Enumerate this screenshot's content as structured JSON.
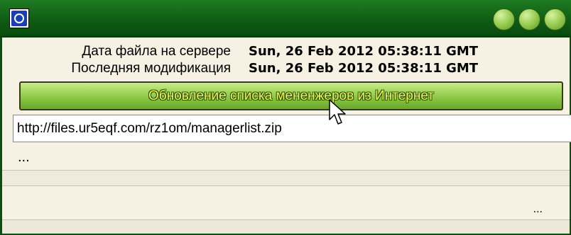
{
  "window": {
    "icon": "app-icon",
    "controls": [
      "minimize-button",
      "maximize-button",
      "close-button"
    ]
  },
  "info": {
    "server_date_label": "Дата файла на сервере",
    "server_date_value": "Sun, 26 Feb 2012 05:38:11 GMT",
    "modified_label": "Последняя модификация",
    "modified_value": "Sun, 26 Feb 2012 05:38:11 GMT"
  },
  "update_button": {
    "label": "Обновление списка мененжеров из Интернет"
  },
  "url_field": {
    "value": "http://files.ur5eqf.com/rz1om/managerlist.zip"
  },
  "status": {
    "line1": "...",
    "line2": "...",
    "progress": 0
  },
  "colors": {
    "titlebar": "#0f5d14",
    "button_green": "#8fc94a",
    "button_text": "#f4f24a",
    "panel_bg": "#f6f1e2"
  }
}
